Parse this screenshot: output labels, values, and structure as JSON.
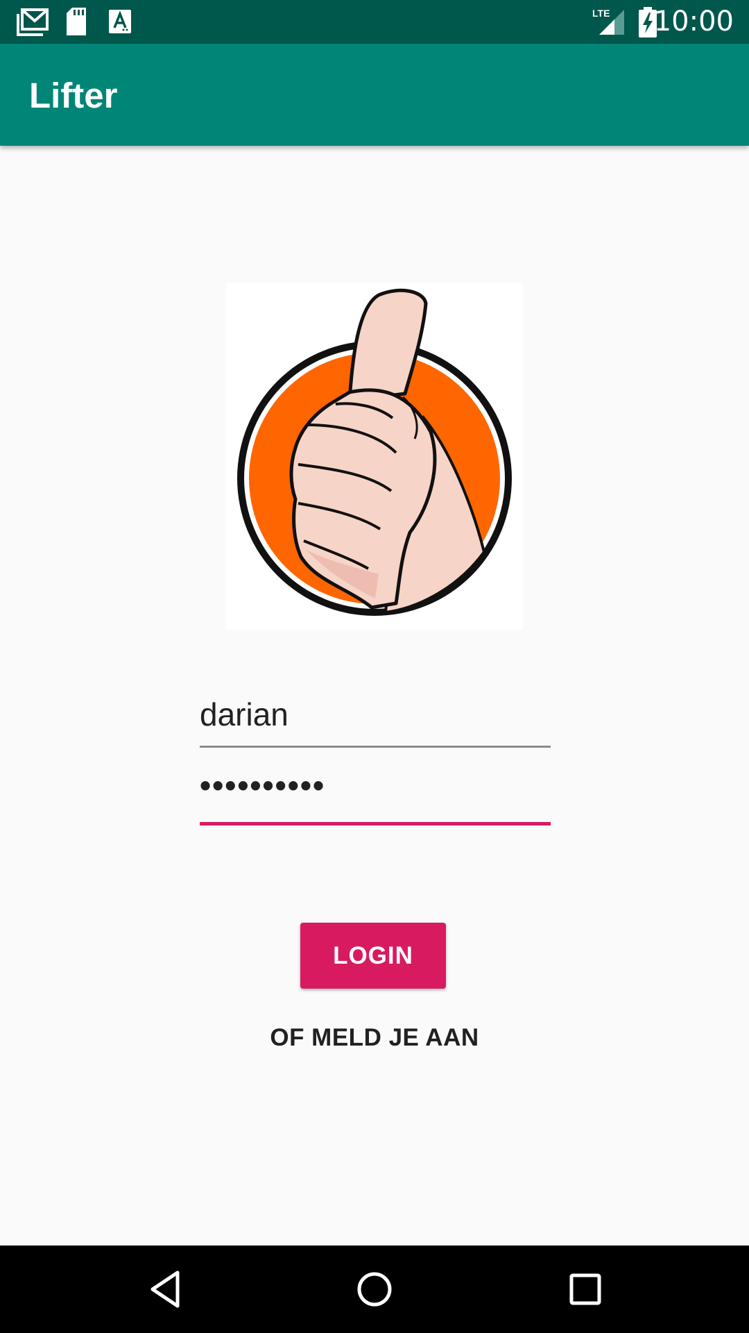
{
  "status_bar": {
    "time": "10:00",
    "network_label": "LTE",
    "icons": [
      "gmail-icon",
      "sd-card-icon",
      "text-a-icon",
      "lte-signal-icon",
      "battery-charging-icon"
    ]
  },
  "app_bar": {
    "title": "Lifter"
  },
  "logo": {
    "icon": "thumbs-up-logo",
    "colors": {
      "circle": "#ff6600",
      "ring": "#111111",
      "hand": "#f7d4c8"
    }
  },
  "login_form": {
    "username_value": "darian",
    "password_value": "••••••••••",
    "login_label": "LOGIN",
    "register_label": "OF MELD JE AAN"
  },
  "nav_bar": {
    "buttons": [
      "back-icon",
      "home-icon",
      "recents-icon"
    ]
  },
  "colors": {
    "status_bar": "#00574b",
    "app_bar": "#008577",
    "accent": "#d81b60",
    "background": "#fafafa"
  }
}
